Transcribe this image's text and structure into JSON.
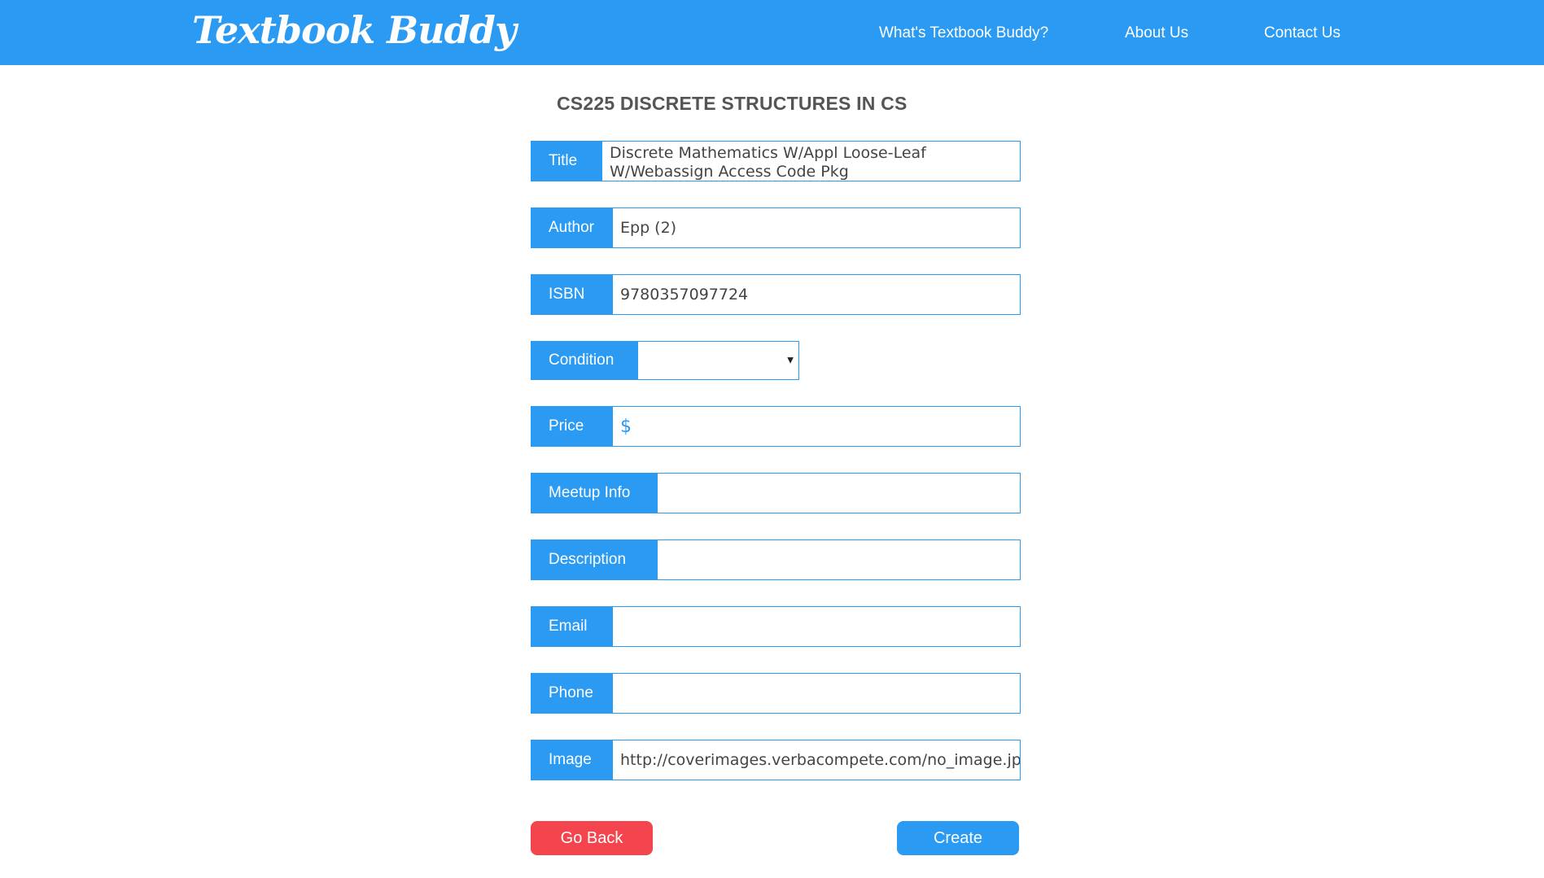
{
  "header": {
    "logo": "Textbook Buddy",
    "nav": [
      {
        "label": "What's Textbook Buddy?"
      },
      {
        "label": "About Us"
      },
      {
        "label": "Contact Us"
      }
    ]
  },
  "course": {
    "title": "CS225 DISCRETE STRUCTURES IN CS"
  },
  "form": {
    "title": {
      "label": "Title",
      "value": "Discrete Mathematics W/Appl Loose-Leaf W/Webassign Access Code Pkg"
    },
    "author": {
      "label": "Author",
      "value": "Epp (2)"
    },
    "isbn": {
      "label": "ISBN",
      "value": "9780357097724"
    },
    "condition": {
      "label": "Condition",
      "value": ""
    },
    "price": {
      "label": "Price",
      "prefix": "$",
      "value": ""
    },
    "meetup": {
      "label": "Meetup Info",
      "value": ""
    },
    "description": {
      "label": "Description",
      "value": ""
    },
    "email": {
      "label": "Email",
      "value": ""
    },
    "phone": {
      "label": "Phone",
      "value": ""
    },
    "image": {
      "label": "Image",
      "value": "http://coverimages.verbacompete.com/no_image.jpg"
    }
  },
  "buttons": {
    "back": "Go Back",
    "create": "Create"
  },
  "colors": {
    "primary": "#2b9af3",
    "danger": "#f4454e",
    "heading": "#555555"
  }
}
